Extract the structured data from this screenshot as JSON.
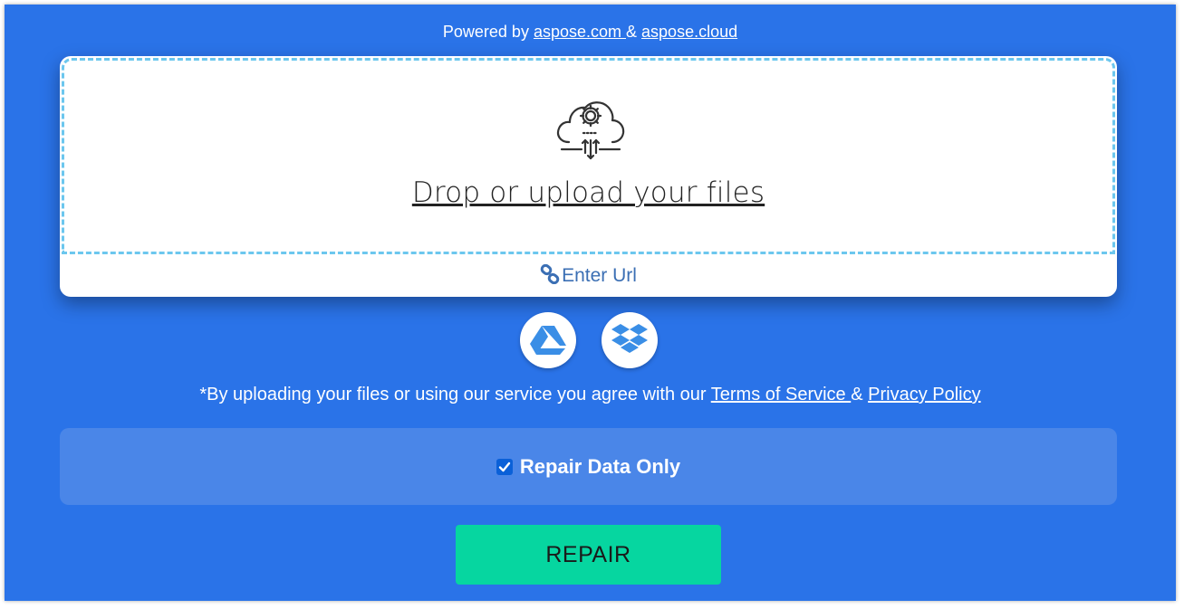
{
  "header": {
    "powered_prefix": "Powered by ",
    "link1": "aspose.com ",
    "amp": " & ",
    "link2": "aspose.cloud"
  },
  "upload": {
    "drop_text": "Drop or upload your files",
    "enter_url": "Enter Url",
    "cloud_icon": "cloud-upload-gear-icon"
  },
  "sources": {
    "google_drive_icon": "google-drive-icon",
    "dropbox_icon": "dropbox-icon"
  },
  "terms": {
    "prefix": "*By uploading your files or using our service you agree with our ",
    "tos": "Terms of Service ",
    "amp": " & ",
    "privacy": "Privacy Policy"
  },
  "options": {
    "repair_data_only_label": "Repair Data Only",
    "repair_data_only_checked": true
  },
  "actions": {
    "repair_label": "REPAIR"
  },
  "colors": {
    "background": "#2a73e8",
    "options_panel": "#4a86e8",
    "repair_button": "#06d6a0",
    "drop_border": "#6cc7ee",
    "link_blue": "#3b6fb4"
  }
}
